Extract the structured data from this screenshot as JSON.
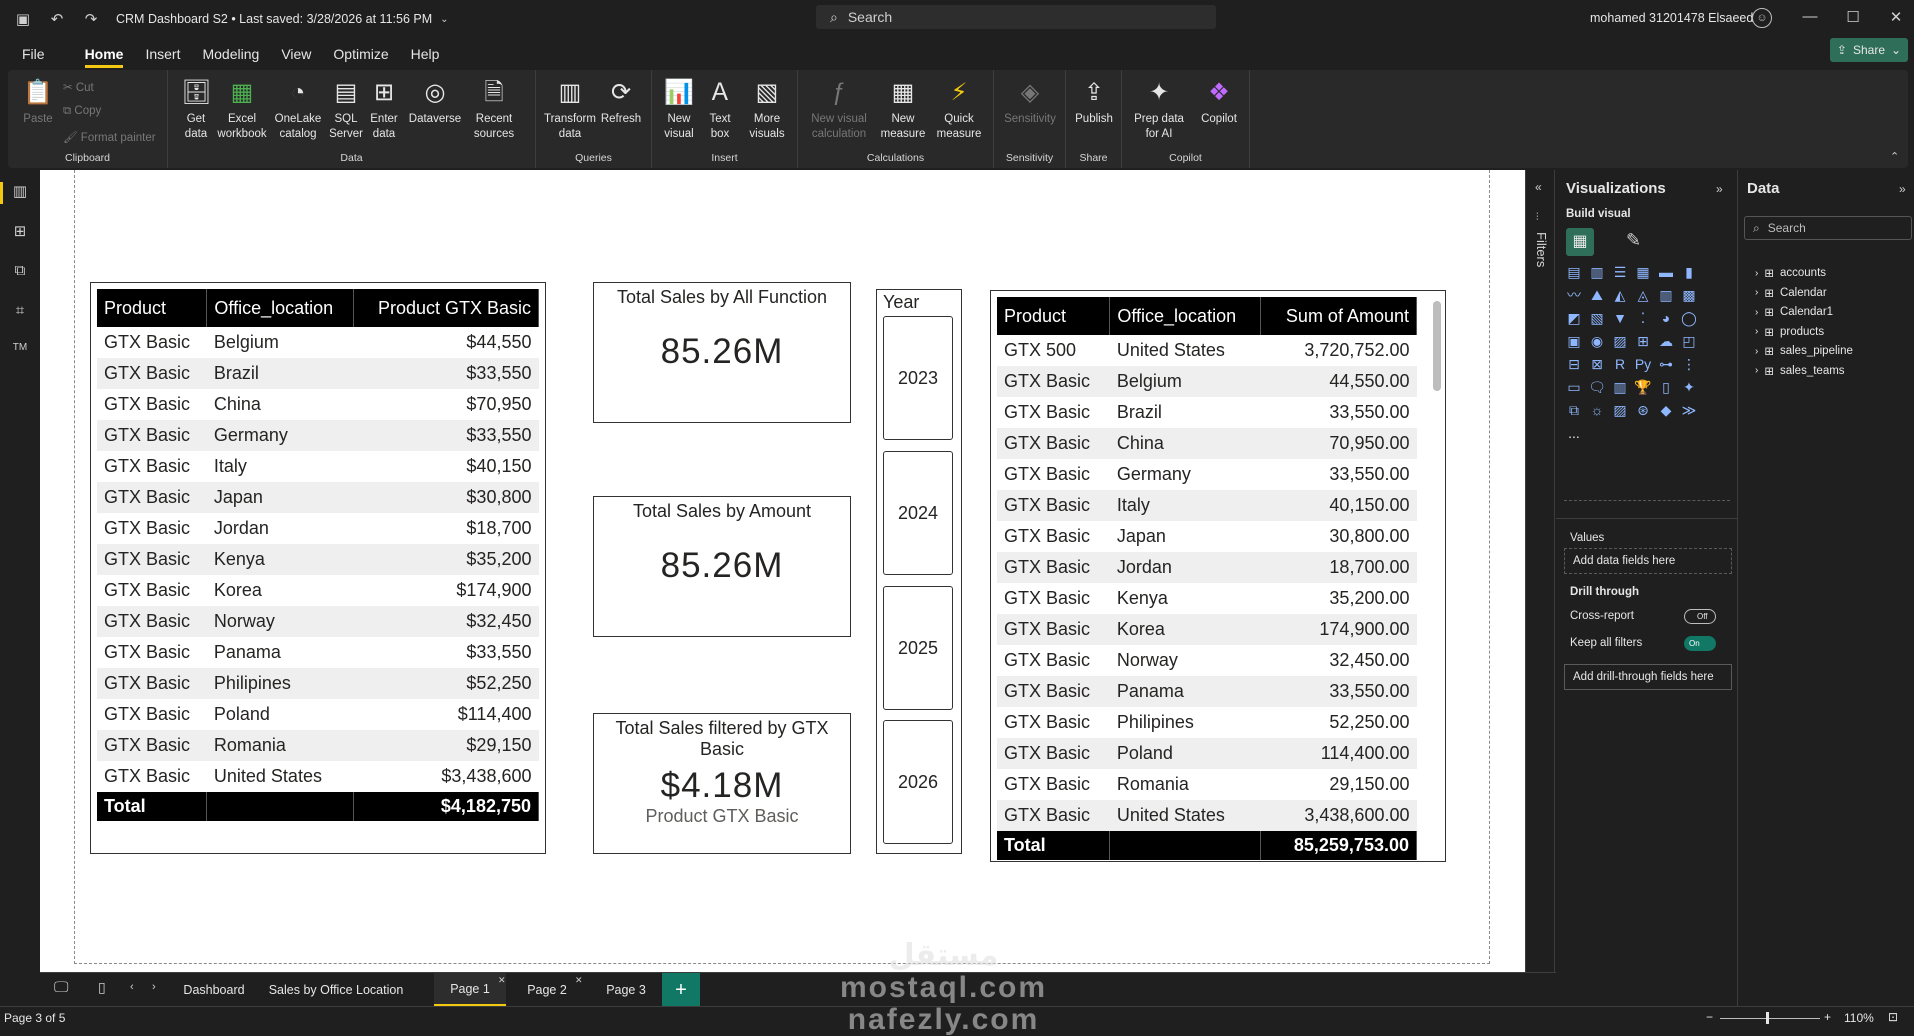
{
  "titlebar": {
    "title": "CRM Dashboard S2 • Last saved: 3/28/2026 at 11:56 PM",
    "search_placeholder": "Search",
    "user": "mohamed 31201478 Elsaeed"
  },
  "menu": [
    "File",
    "Home",
    "Insert",
    "Modeling",
    "View",
    "Optimize",
    "Help"
  ],
  "share_label": "Share",
  "ribbon": {
    "clipboard": {
      "paste": "Paste",
      "cut": "Cut",
      "copy": "Copy",
      "format_painter": "Format painter",
      "label": "Clipboard"
    },
    "data": {
      "get_data": "Get data",
      "excel": "Excel workbook",
      "onelake": "OneLake catalog",
      "sql": "SQL Server",
      "enter": "Enter data",
      "dataverse": "Dataverse",
      "recent": "Recent sources",
      "label": "Data"
    },
    "queries": {
      "transform": "Transform data",
      "refresh": "Refresh",
      "label": "Queries"
    },
    "insert": {
      "new_visual": "New visual",
      "text_box": "Text box",
      "more_visuals": "More visuals",
      "label": "Insert"
    },
    "calculations": {
      "new_visual_calc": "New visual calculation",
      "new_measure": "New measure",
      "quick_measure": "Quick measure",
      "label": "Calculations"
    },
    "sensitivity": {
      "btn": "Sensitivity",
      "label": "Sensitivity"
    },
    "share": {
      "publish": "Publish",
      "label": "Share"
    },
    "copilot": {
      "prep": "Prep data for AI",
      "copilot": "Copilot",
      "label": "Copilot"
    }
  },
  "table1": {
    "headers": [
      "Product",
      "Office_location",
      "Product GTX Basic"
    ],
    "rows": [
      [
        "GTX Basic",
        "Belgium",
        "$44,550"
      ],
      [
        "GTX Basic",
        "Brazil",
        "$33,550"
      ],
      [
        "GTX Basic",
        "China",
        "$70,950"
      ],
      [
        "GTX Basic",
        "Germany",
        "$33,550"
      ],
      [
        "GTX Basic",
        "Italy",
        "$40,150"
      ],
      [
        "GTX Basic",
        "Japan",
        "$30,800"
      ],
      [
        "GTX Basic",
        "Jordan",
        "$18,700"
      ],
      [
        "GTX Basic",
        "Kenya",
        "$35,200"
      ],
      [
        "GTX Basic",
        "Korea",
        "$174,900"
      ],
      [
        "GTX Basic",
        "Norway",
        "$32,450"
      ],
      [
        "GTX Basic",
        "Panama",
        "$33,550"
      ],
      [
        "GTX Basic",
        "Philipines",
        "$52,250"
      ],
      [
        "GTX Basic",
        "Poland",
        "$114,400"
      ],
      [
        "GTX Basic",
        "Romania",
        "$29,150"
      ],
      [
        "GTX Basic",
        "United States",
        "$3,438,600"
      ]
    ],
    "total": [
      "Total",
      "",
      "$4,182,750"
    ]
  },
  "cards": [
    {
      "title": "Total Sales by All Function",
      "value": "85.26M",
      "sub": ""
    },
    {
      "title": "Total Sales by Amount",
      "value": "85.26M",
      "sub": ""
    },
    {
      "title": "Total Sales filtered by GTX Basic",
      "value": "$4.18M",
      "sub": "Product GTX Basic"
    }
  ],
  "slicer": {
    "title": "Year",
    "items": [
      "2023",
      "2024",
      "2025",
      "2026"
    ]
  },
  "table2": {
    "headers": [
      "Product",
      "Office_location",
      "Sum of Amount"
    ],
    "rows": [
      [
        "GTX 500",
        "United States",
        "3,720,752.00"
      ],
      [
        "GTX Basic",
        "Belgium",
        "44,550.00"
      ],
      [
        "GTX Basic",
        "Brazil",
        "33,550.00"
      ],
      [
        "GTX Basic",
        "China",
        "70,950.00"
      ],
      [
        "GTX Basic",
        "Germany",
        "33,550.00"
      ],
      [
        "GTX Basic",
        "Italy",
        "40,150.00"
      ],
      [
        "GTX Basic",
        "Japan",
        "30,800.00"
      ],
      [
        "GTX Basic",
        "Jordan",
        "18,700.00"
      ],
      [
        "GTX Basic",
        "Kenya",
        "35,200.00"
      ],
      [
        "GTX Basic",
        "Korea",
        "174,900.00"
      ],
      [
        "GTX Basic",
        "Norway",
        "32,450.00"
      ],
      [
        "GTX Basic",
        "Panama",
        "33,550.00"
      ],
      [
        "GTX Basic",
        "Philipines",
        "52,250.00"
      ],
      [
        "GTX Basic",
        "Poland",
        "114,400.00"
      ],
      [
        "GTX Basic",
        "Romania",
        "29,150.00"
      ],
      [
        "GTX Basic",
        "United States",
        "3,438,600.00"
      ]
    ],
    "total": [
      "Total",
      "",
      "85,259,753.00"
    ]
  },
  "filters_label": "Filters",
  "viz": {
    "title": "Visualizations",
    "build": "Build visual",
    "values": "Values",
    "add_fields": "Add data fields here",
    "drill": "Drill through",
    "cross": "Cross-report",
    "cross_state": "Off",
    "keep": "Keep all filters",
    "keep_state": "On",
    "add_drill": "Add drill-through fields here",
    "more": "..."
  },
  "datapane": {
    "title": "Data",
    "search": "Search",
    "items": [
      "accounts",
      "Calendar",
      "Calendar1",
      "products",
      "sales_pipeline",
      "sales_teams"
    ]
  },
  "pages": [
    "Dashboard",
    "Sales by Office Location",
    "Page 1",
    "Page 2",
    "Page 3"
  ],
  "status": {
    "page": "Page 3 of 5",
    "zoom": "110%"
  },
  "watermark": {
    "line1": "مستقل",
    "line2": "mostaql.com",
    "line3": "nafezly.com"
  }
}
